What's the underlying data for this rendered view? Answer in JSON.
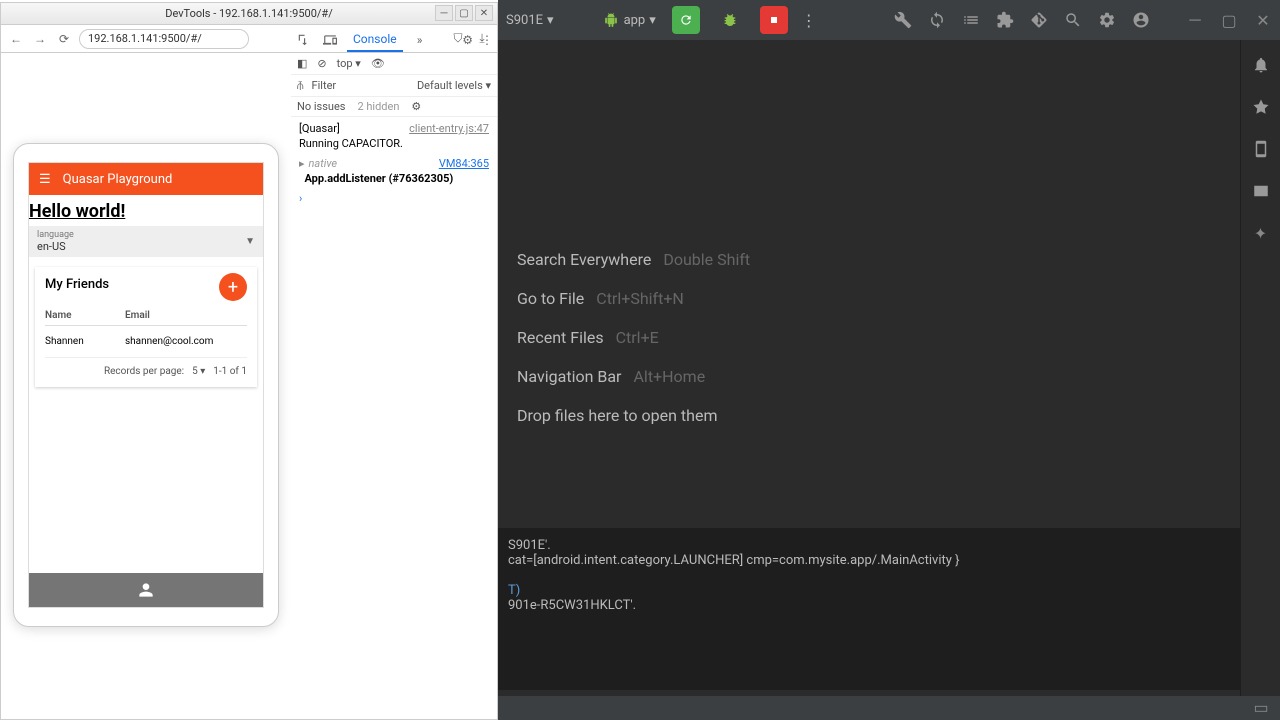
{
  "devtools": {
    "title": "DevTools - 192.168.1.141:9500/#/",
    "url": "192.168.1.141:9500/#/",
    "tabs": {
      "console": "Console"
    },
    "sub": {
      "context": "top",
      "filter": "Filter",
      "levels": "Default levels",
      "no_issues": "No issues",
      "hidden": "2 hidden"
    },
    "logs": {
      "l1_tag": "[Quasar]",
      "l1_link": "client-entry.js:47",
      "l1_body": "Running CAPACITOR.",
      "l2_native": "native",
      "l2_link": "VM84:365",
      "l2_body": "App.addListener (#76362305)"
    }
  },
  "ide": {
    "device": "S901E",
    "app": "app",
    "welcome": {
      "search": "Search Everywhere",
      "search_k": "Double Shift",
      "goto": "Go to File",
      "goto_k": "Ctrl+Shift+N",
      "recent": "Recent Files",
      "recent_k": "Ctrl+E",
      "nav": "Navigation Bar",
      "nav_k": "Alt+Home",
      "drop": "Drop files here to open them"
    },
    "terminal": {
      "l1": "S901E'.",
      "l2": "cat=[android.intent.category.LAUNCHER] cmp=com.mysite.app/.MainActivity }",
      "l3": "T)",
      "l4": "901e-R5CW31HKLCT'."
    }
  },
  "app": {
    "header": "Quasar Playground",
    "h1": "Hello world!",
    "lang_label": "language",
    "lang_value": "en-US",
    "friends_title": "My Friends",
    "cols": {
      "name": "Name",
      "email": "Email"
    },
    "row": {
      "name": "Shannen",
      "email": "shannen@cool.com"
    },
    "pager": {
      "rpp": "Records per page:",
      "rpp_val": "5",
      "range": "1-1 of 1"
    }
  }
}
